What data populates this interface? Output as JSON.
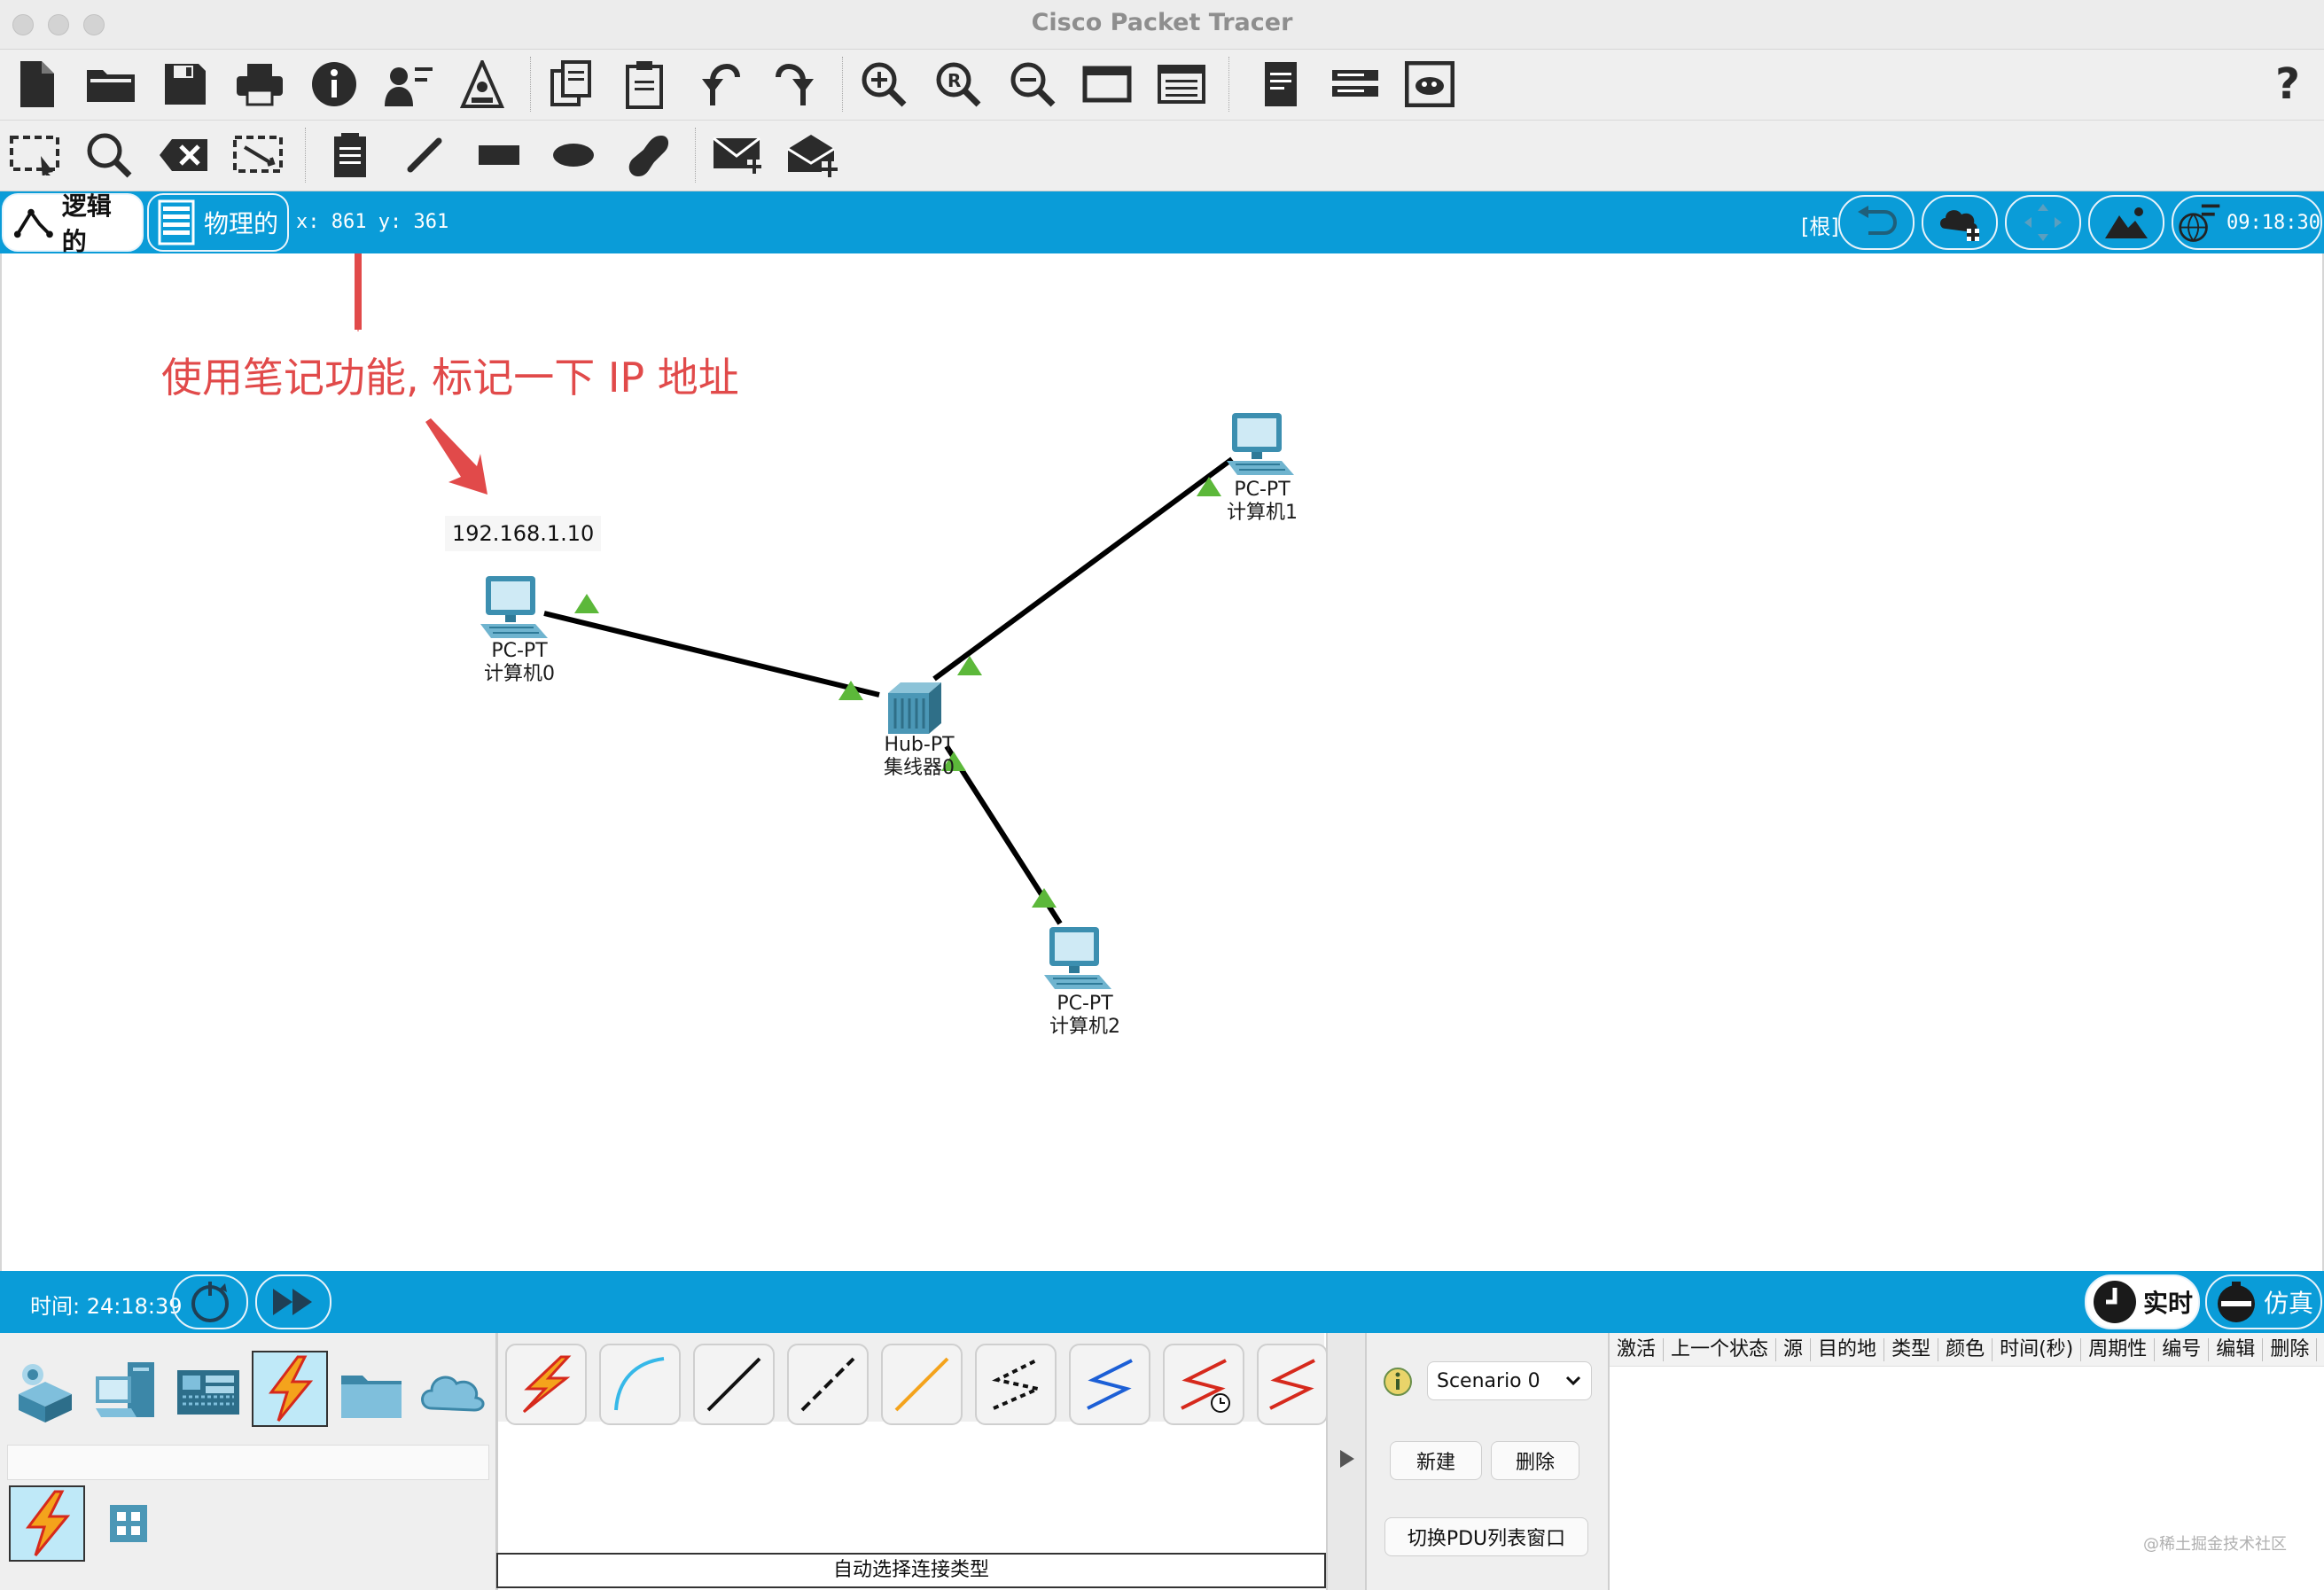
{
  "window": {
    "title": "Cisco Packet Tracer"
  },
  "toolbar_main": {
    "icons": [
      "new-file-icon",
      "open-folder-icon",
      "save-icon",
      "print-icon",
      "info-icon",
      "activity-wizard-icon",
      "custom-device-icon",
      "copy-icon",
      "paste-icon",
      "undo-icon",
      "redo-icon",
      "zoom-in-icon",
      "zoom-reset-icon",
      "zoom-out-icon",
      "drawing-palette-icon",
      "custom-devices-dialog-icon",
      "device-template-icon",
      "network-info-icon",
      "cluster-icon"
    ],
    "help_label": "?"
  },
  "toolbar_tools": {
    "icons": [
      "select-icon",
      "inspect-icon",
      "delete-icon",
      "resize-icon",
      "note-icon",
      "line-draw-icon",
      "rectangle-icon",
      "ellipse-icon",
      "freeform-icon",
      "simple-pdu-icon",
      "complex-pdu-icon"
    ]
  },
  "topbar": {
    "tab_logical": "逻辑的",
    "tab_physical": "物理的",
    "coords_text": "x: 861 y: 361",
    "root_label": "[根]",
    "clock": "09:18:30"
  },
  "canvas": {
    "note_text": "192.168.1.10",
    "annotation_text": "使用笔记功能, 标记一下 IP 地址",
    "nodes": [
      {
        "type": "PC-PT",
        "name": "计算机0"
      },
      {
        "type": "PC-PT",
        "name": "计算机1"
      },
      {
        "type": "PC-PT",
        "name": "计算机2"
      },
      {
        "type": "Hub-PT",
        "name": "集线器0"
      }
    ]
  },
  "bottombar": {
    "time_label": "时间: 24:18:39",
    "realtime_label": "实时",
    "simulation_label": "仿真"
  },
  "device_panel": {
    "categories": [
      "network-devices-icon",
      "end-devices-icon",
      "components-icon",
      "connections-icon",
      "misc-icon",
      "multiuser-cloud-icon"
    ],
    "subcategories": [
      "connections-icon",
      "grid-icon"
    ]
  },
  "connections": {
    "description": "自动选择连接类型",
    "types": [
      "auto-connection",
      "console-cable",
      "copper-straight-through",
      "copper-cross-over",
      "fiber",
      "phone",
      "coaxial",
      "serial-dce",
      "serial-dte"
    ]
  },
  "scenario": {
    "selected": "Scenario 0",
    "new_label": "新建",
    "delete_label": "删除",
    "toggle_pdu_label": "切换PDU列表窗口"
  },
  "pdu_table": {
    "columns": [
      "激活",
      "上一个状态",
      "源",
      "目的地",
      "类型",
      "颜色",
      "时间(秒)",
      "周期性",
      "编号",
      "编辑",
      "删除"
    ]
  },
  "watermark": "@稀土掘金技术社区",
  "colors": {
    "bar_blue": "#0a9cd8",
    "link_up": "#5cb83a",
    "annotation_red": "#e14a4a"
  }
}
